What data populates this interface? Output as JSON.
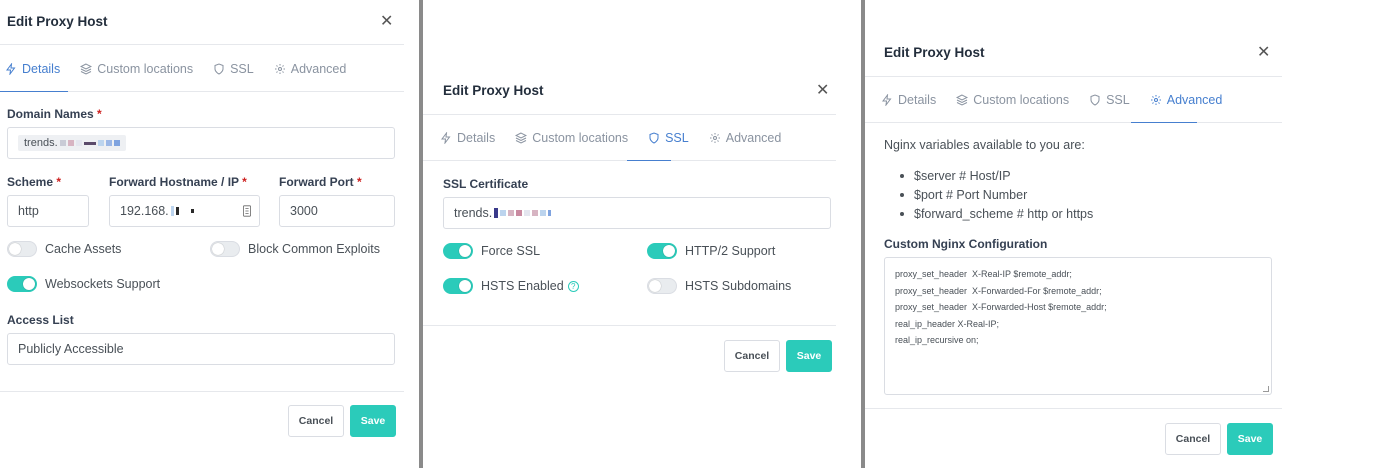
{
  "dialog": {
    "title": "Edit Proxy Host",
    "close_glyph": "✕",
    "tabs": {
      "details": "Details",
      "custom_locations": "Custom locations",
      "ssl": "SSL",
      "advanced": "Advanced"
    },
    "cancel_label": "Cancel",
    "save_label": "Save"
  },
  "details": {
    "domain_names_label": "Domain Names",
    "domain_value": "trends.",
    "scheme_label": "Scheme",
    "scheme_value": "http",
    "forward_host_label": "Forward Hostname / IP",
    "forward_host_value": "192.168.",
    "forward_port_label": "Forward Port",
    "forward_port_value": "3000",
    "cache_assets_label": "Cache Assets",
    "cache_assets_on": false,
    "block_exploits_label": "Block Common Exploits",
    "block_exploits_on": false,
    "websockets_label": "Websockets Support",
    "websockets_on": true,
    "access_list_label": "Access List",
    "access_list_value": "Publicly Accessible"
  },
  "ssl": {
    "certificate_label": "SSL Certificate",
    "certificate_value": "trends.",
    "force_ssl_label": "Force SSL",
    "force_ssl_on": true,
    "http2_label": "HTTP/2 Support",
    "http2_on": true,
    "hsts_label": "HSTS Enabled",
    "hsts_on": true,
    "hsts_sub_label": "HSTS Subdomains",
    "hsts_sub_on": false
  },
  "advanced": {
    "intro": "Nginx variables available to you are:",
    "variables": [
      "$server # Host/IP",
      "$port # Port Number",
      "$forward_scheme # http or https"
    ],
    "config_label": "Custom Nginx Configuration",
    "config_lines": [
      "proxy_set_header  X-Real-IP $remote_addr;",
      "proxy_set_header  X-Forwarded-For $remote_addr;",
      "proxy_set_header  X-Forwarded-Host $remote_addr;",
      "real_ip_header X-Real-IP;",
      "real_ip_recursive on;"
    ]
  },
  "colors": {
    "accent": "#467fcf",
    "toggle_on": "#2bcbba",
    "required": "#cd201f",
    "divider": "#8a8a8a"
  }
}
